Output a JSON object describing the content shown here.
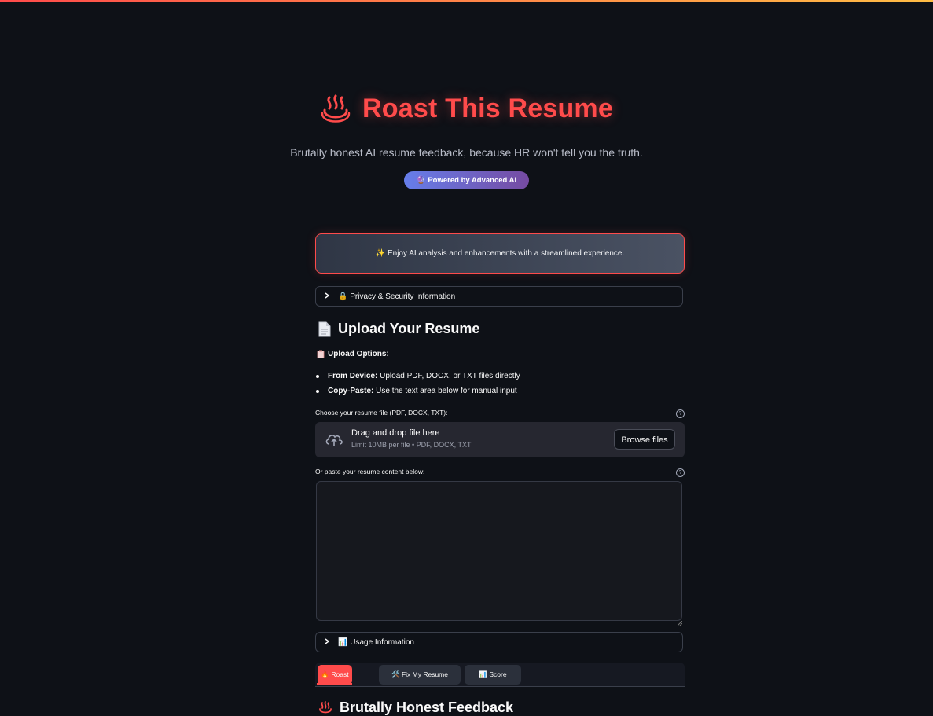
{
  "header": {
    "title": "Roast This Resume",
    "subtitle": "Brutally honest AI resume feedback, because HR won't tell you the truth.",
    "badge": "🔮 Powered by Advanced AI"
  },
  "notice": {
    "text": "✨ Enjoy AI analysis and enhancements with a streamlined experience."
  },
  "privacy_expander": {
    "label": "🔒 Privacy & Security Information"
  },
  "upload_section": {
    "title": "Upload Your Resume",
    "options_heading": "Upload Options:",
    "bullets": [
      {
        "bold": "From Device:",
        "text": " Upload PDF, DOCX, or TXT files directly"
      },
      {
        "bold": "Copy-Paste:",
        "text": " Use the text area below for manual input"
      }
    ],
    "file_label": "Choose your resume file (PDF, DOCX, TXT):",
    "dropzone_main": "Drag and drop file here",
    "dropzone_sub": "Limit 10MB per file • PDF, DOCX, TXT",
    "browse_label": "Browse files",
    "paste_label": "Or paste your resume content below:",
    "paste_value": ""
  },
  "usage_expander": {
    "label": "📊 Usage Information"
  },
  "tabs": [
    {
      "label": "🔥 Roast"
    },
    {
      "label": "🛠️ Fix My Resume"
    },
    {
      "label": "📊 Score"
    }
  ],
  "feedback_section": {
    "title": "Brutally Honest Feedback"
  },
  "colors": {
    "accent": "#ff4b4b",
    "background": "#0e1117",
    "badge_start": "#667eea",
    "badge_end": "#764ba2"
  }
}
